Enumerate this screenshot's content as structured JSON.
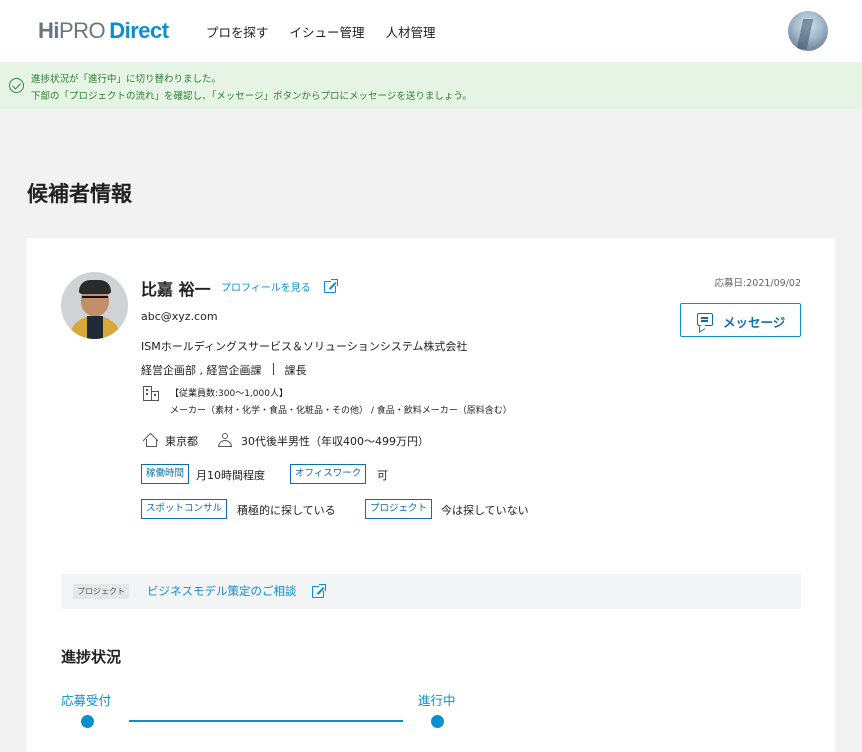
{
  "header": {
    "logo": {
      "hi": "Hi",
      "pro": "PRO",
      "direct": "Direct"
    },
    "nav": [
      "プロを探す",
      "イシュー管理",
      "人材管理"
    ]
  },
  "notice": {
    "line1": "進捗状況が「進行中」に切り替わりました。",
    "line2": "下部の「プロジェクトの流れ」を確認し、「メッセージ」ボタンからプロにメッセージを送りましょう。"
  },
  "page": {
    "title": "候補者情報"
  },
  "candidate": {
    "name": "比嘉 裕一",
    "profile_link": "プロフィールを見る",
    "applied_date": "応募日:2021/09/02",
    "message_button": "メッセージ",
    "email": "abc@xyz.com",
    "company": "ISMホールディングスサービス＆ソリューションシステム株式会社",
    "department": "経営企画部 , 経営企画課",
    "position": "課長",
    "employees": "【従業員数:300〜1,000人】",
    "industry": "メーカー（素材・化学・食品・化粧品・その他） / 食品・飲料メーカー（原料含む）",
    "location": "東京都",
    "attributes": "30代後半男性（年収400〜499万円）",
    "tags": [
      {
        "label": "稼働時間",
        "value": "月10時間程度"
      },
      {
        "label": "オフィスワーク",
        "value": "可"
      },
      {
        "label": "スポットコンサル",
        "value": "積極的に探している"
      },
      {
        "label": "プロジェクト",
        "value": "今は探していない"
      }
    ]
  },
  "project": {
    "label": "プロジェクト",
    "name": "ビジネスモデル策定のご相談"
  },
  "progress": {
    "title": "進捗状況",
    "steps": [
      "応募受付",
      "進行中"
    ]
  },
  "colors": {
    "accent": "#0b8fd0",
    "notice_bg": "#e6f4e6",
    "notice_text": "#2e7d32"
  }
}
